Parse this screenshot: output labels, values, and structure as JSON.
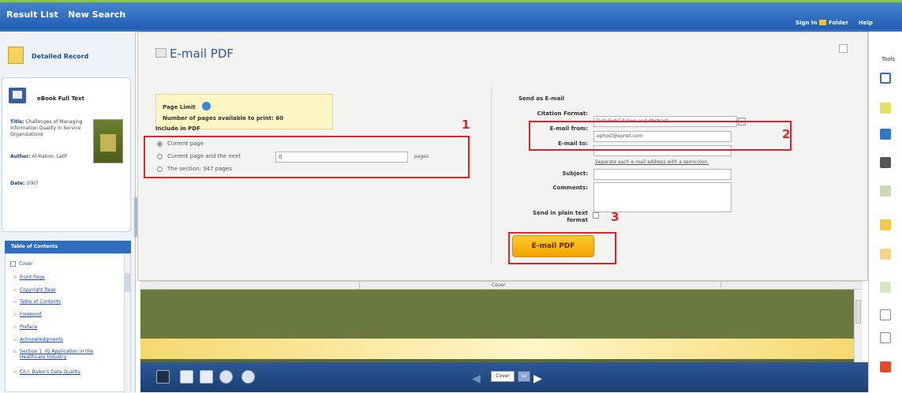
{
  "topbar": {
    "result_list": "Result List",
    "new_search": "New Search",
    "sign_in": "Sign In",
    "folder": "Folder",
    "help": "Help"
  },
  "left": {
    "detailed_record": "Detailed Record",
    "ebook_full_text": "eBook Full Text",
    "meta": {
      "title_label": "Title:",
      "title_value": "Challenges of Managing Information Quality in Service Organizations",
      "author_label": "Author:",
      "author_value": "Al-Hakim, Latif",
      "date_label": "Date:",
      "date_value": "2007"
    },
    "toc_heading": "Table of Contents",
    "toc_cover": "Cover",
    "toc_items": [
      "Front Page",
      "Copyright Page",
      "Table of Contents",
      "Foreword",
      "Preface",
      "Acknowledgments",
      "Section 1: IQ Application in the Healthcare Industry",
      "Ch I: Baleo's Data Quality"
    ]
  },
  "dialog": {
    "title": "E-mail PDF",
    "page_limit_label": "Page Limit",
    "pages_available": "Number of pages available to print: 60",
    "include_heading": "Include in PDF",
    "opt_current": "Current page",
    "opt_next": "Current page and the next",
    "next_value": "0",
    "pages_suffix": "pages",
    "opt_section": "The section: 347 pages",
    "send_as": "Send as E-mail",
    "citation_label": "Citation Format:",
    "citation_value": "Detailed Citation and Abstract",
    "from_label": "E-mail from:",
    "from_value": "ephost@epnet.com",
    "to_label": "E-mail to:",
    "to_hint": "Separate each e-mail address with a semicolon.",
    "subject_label": "Subject:",
    "comments_label": "Comments:",
    "plain_label": "Send in plain text format",
    "button": "E-mail PDF"
  },
  "annotations": [
    "1",
    "2",
    "3"
  ],
  "viewer": {
    "section_label": "Cover",
    "page_box": "Cover",
    "go": "Go"
  },
  "right": {
    "tools_label": "Tools"
  },
  "colors": {
    "annotation": "#e0242b",
    "button_fill": "#f7b500",
    "topbar": "#2b65b3"
  }
}
